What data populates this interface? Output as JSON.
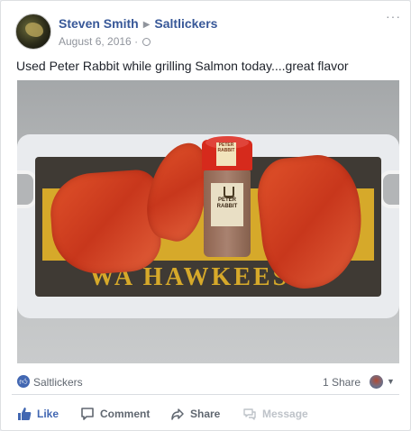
{
  "post": {
    "author": "Steven Smith",
    "page": "Saltlickers",
    "date": "August 6, 2016",
    "text": "Used Peter Rabbit while grilling Salmon today....great flavor",
    "more_label": "···"
  },
  "photo": {
    "board_text": "WA HAWKEES",
    "cap_label": "PETER RABBIT",
    "jar_label": "PETER RABBIT"
  },
  "reactions": {
    "name": "Saltlickers",
    "share_count": "1 Share"
  },
  "actions": {
    "like": "Like",
    "comment": "Comment",
    "share": "Share",
    "message": "Message"
  },
  "colors": {
    "link": "#385898",
    "accent": "#4267b2",
    "muted": "#90949c",
    "disabled": "#bec3c9"
  },
  "icons": {
    "avatar": "avatar",
    "globe": "globe-icon",
    "like": "thumbs-up-icon",
    "comment": "comment-bubble-icon",
    "share": "share-arrow-icon",
    "message": "message-bubble-icon"
  }
}
